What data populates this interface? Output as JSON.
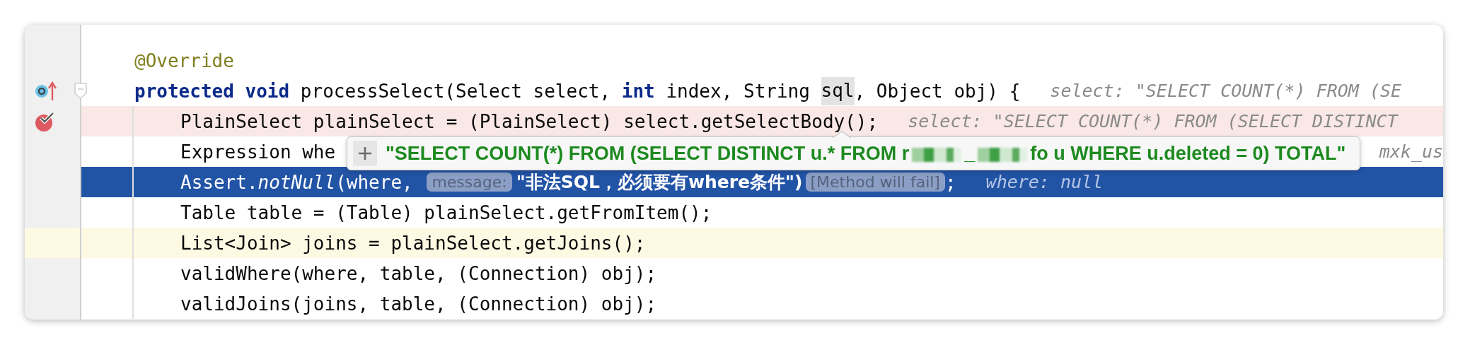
{
  "editor": {
    "lines": [
      {
        "kind": "signature",
        "selected": false,
        "error": false,
        "current": false,
        "fold": false,
        "segments": [
          {
            "kind": "annotation",
            "text": "@Override"
          }
        ]
      },
      {
        "kind": "signature",
        "selected": false,
        "error": false,
        "current": false,
        "fold": true,
        "gutter": [
          {
            "kind": "override"
          }
        ],
        "segments": [
          {
            "kind": "keyword",
            "text": "protected "
          },
          {
            "kind": "keyword",
            "text": "void"
          },
          {
            "kind": "plain",
            "text": " processSelect(Select select, "
          },
          {
            "kind": "keyword",
            "text": "int"
          },
          {
            "kind": "plain",
            "text": " index, String "
          },
          {
            "kind": "hovered",
            "text": "sql"
          },
          {
            "kind": "plain",
            "text": ", Object obj) {"
          },
          {
            "kind": "inline_hint",
            "text": "select: \"SELECT COUNT(*) FROM (SE"
          }
        ]
      },
      {
        "kind": "body",
        "selected": false,
        "error": true,
        "current": false,
        "fold": false,
        "gutter": [
          {
            "kind": "breakpoint_check"
          }
        ],
        "segments": [
          {
            "kind": "plain",
            "text": "PlainSelect plainSelect = (PlainSelect) select.getSelectBody();"
          },
          {
            "kind": "inline_hint",
            "text": "select: \"SELECT COUNT(*) FROM (SELECT DISTINCT"
          }
        ]
      },
      {
        "kind": "body",
        "selected": false,
        "error": false,
        "current": false,
        "fold": false,
        "segments": [
          {
            "kind": "plain",
            "text": "Expression whe"
          },
          {
            "kind": "covered"
          },
          {
            "kind": "inline_hint",
            "text": "mxk_us"
          }
        ]
      },
      {
        "kind": "body",
        "selected": true,
        "error": false,
        "current": false,
        "fold": false,
        "segments": [
          {
            "kind": "plain",
            "text": "Assert."
          },
          {
            "kind": "italic",
            "text": "notNull"
          },
          {
            "kind": "plain",
            "text": "(where, "
          },
          {
            "kind": "param_hint",
            "text": "message:"
          },
          {
            "kind": "string",
            "text": "\"非法SQL，必须要有where条件\")"
          },
          {
            "kind": "fail_badge",
            "text": "[Method will fail]"
          },
          {
            "kind": "plain",
            "text": ";"
          },
          {
            "kind": "inline_hint",
            "text": "where: null"
          }
        ]
      },
      {
        "kind": "body",
        "selected": false,
        "error": false,
        "current": false,
        "fold": false,
        "segments": [
          {
            "kind": "plain",
            "text": "Table table = (Table) plainSelect.getFromItem();"
          }
        ]
      },
      {
        "kind": "body",
        "selected": false,
        "error": false,
        "current": true,
        "fold": false,
        "segments": [
          {
            "kind": "plain",
            "text": "List<Join> joins = plainSelect.getJoins();"
          }
        ]
      },
      {
        "kind": "body",
        "selected": false,
        "error": false,
        "current": false,
        "fold": false,
        "segments": [
          {
            "kind": "plain",
            "text": "validWhere(where, table, (Connection) obj);"
          }
        ]
      },
      {
        "kind": "body",
        "selected": false,
        "error": false,
        "current": false,
        "fold": false,
        "segments": [
          {
            "kind": "plain",
            "text": "validJoins(joins, table, (Connection) obj);"
          }
        ]
      }
    ]
  },
  "tooltip": {
    "parts": [
      {
        "kind": "text",
        "text": "\"SELECT COUNT(*) FROM (SELECT DISTINCT u.* FROM r"
      },
      {
        "kind": "redacted"
      },
      {
        "kind": "text",
        "text": "_"
      },
      {
        "kind": "redacted"
      },
      {
        "kind": "text",
        "text": "fo u WHERE u.deleted = 0) TOTAL\""
      }
    ]
  }
}
